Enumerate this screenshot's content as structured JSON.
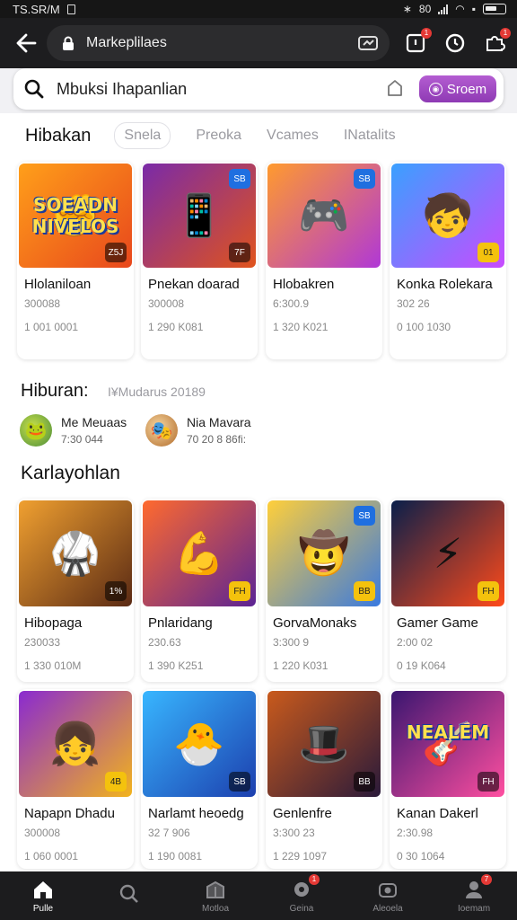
{
  "status_bar": {
    "time": "TS.SR/M",
    "battery_text": "80"
  },
  "browser": {
    "url": "Markeplilaes",
    "notif_count": "1",
    "alert_count": "1"
  },
  "search": {
    "placeholder": "Mbuksi Ihapanlian",
    "button_label": "Sroem"
  },
  "tabs": {
    "title": "Hibakan",
    "items": [
      "Snela",
      "Preoka",
      "Vcames",
      "INatalits"
    ]
  },
  "featured": [
    {
      "name": "Hlolaniloan",
      "sub": "300088",
      "price": "1 001 0001",
      "art": "SOEADN NIVELOS",
      "badge": "Z5J",
      "colors": [
        "#ff9f1a",
        "#e8471c"
      ]
    },
    {
      "name": "Pnekan doarad",
      "sub": "300008",
      "price": "1 290 K081",
      "badge": "7F",
      "badge_top": "SB",
      "colors": [
        "#7a2aa8",
        "#e0531c"
      ]
    },
    {
      "name": "Hlobakren",
      "sub": "6:300.9",
      "price": "1 320 K021",
      "badge_top": "SB",
      "colors": [
        "#ff9a2e",
        "#b038d6"
      ]
    },
    {
      "name": "Konka Rolekara",
      "sub": "302 26",
      "price": "0 100 1030",
      "badge": "01",
      "colors": [
        "#3aa0ff",
        "#c84bff"
      ]
    }
  ],
  "hiburan": {
    "title": "Hiburan:",
    "subtitle": "I¥Mudarus 20189",
    "items": [
      {
        "name": "Me Meuaas",
        "sub": "7:30 044"
      },
      {
        "name": "Nia Mavara",
        "sub": "70 20 8 86fi:"
      }
    ]
  },
  "section2": {
    "title": "Karlayohlan"
  },
  "games_row1": [
    {
      "name": "Hibopaga",
      "sub": "230033",
      "price": "1 330 010M",
      "badge": "1%",
      "colors": [
        "#f0a030",
        "#5a2a14"
      ]
    },
    {
      "name": "Pnlaridang",
      "sub": "230.63",
      "price": "1 390 K251",
      "badge": "FH",
      "colors": [
        "#ff6a2e",
        "#5b2394"
      ]
    },
    {
      "name": "GorvaMonaks",
      "sub": "3:300 9",
      "price": "1 220 K031",
      "badge": "BB",
      "badge_top": "SB",
      "colors": [
        "#ffcf3a",
        "#3a7adf"
      ]
    },
    {
      "name": "Gamer Game",
      "sub": "2:00 02",
      "price": "0 19 K064",
      "badge": "FH",
      "colors": [
        "#0a1f4a",
        "#ff4a1a"
      ]
    }
  ],
  "games_row2": [
    {
      "name": "Napapn Dhadu",
      "sub": "300008",
      "price": "1 060 0001",
      "badge": "4B",
      "colors": [
        "#8a2ad0",
        "#f2b31c"
      ]
    },
    {
      "name": "Narlamt heoedg",
      "sub": "32 7 906",
      "price": "1 190 0081",
      "badge": "SB",
      "colors": [
        "#38b6ff",
        "#1c3fae"
      ]
    },
    {
      "name": "Genlenfre",
      "sub": "3:300 23",
      "price": "1 229 1097",
      "badge": "BB",
      "colors": [
        "#c95a1c",
        "#2a1a3a"
      ]
    },
    {
      "name": "Kanan Dakerl",
      "sub": "2:30.98",
      "price": "0 30 1064",
      "badge": "FH",
      "art": "NEALEM",
      "colors": [
        "#3a1670",
        "#ff4fa0"
      ]
    }
  ],
  "bottom_nav": [
    {
      "label": "Pulle",
      "icon": "home-icon",
      "active": true
    },
    {
      "label": "",
      "icon": "search-icon",
      "active": false
    },
    {
      "label": "Motloa",
      "icon": "store-icon",
      "active": false
    },
    {
      "label": "Geina",
      "icon": "game-icon",
      "active": false,
      "dot": "1"
    },
    {
      "label": "Aleoela",
      "icon": "camera-icon",
      "active": false
    },
    {
      "label": "Ioemam",
      "icon": "profile-icon",
      "active": false,
      "dot": "7"
    }
  ]
}
